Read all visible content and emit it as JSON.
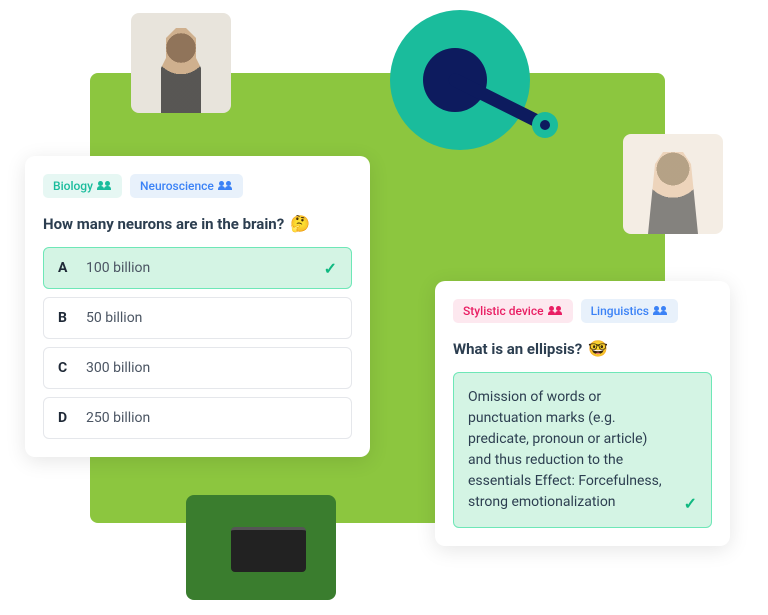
{
  "card1": {
    "tags": [
      {
        "label": "Biology",
        "style": "green"
      },
      {
        "label": "Neuroscience",
        "style": "blue"
      }
    ],
    "question": "How many neurons are in the brain?",
    "emoji": "🤔",
    "options": [
      {
        "letter": "A",
        "text": "100 billion",
        "correct": true
      },
      {
        "letter": "B",
        "text": "50 billion",
        "correct": false
      },
      {
        "letter": "C",
        "text": "300 billion",
        "correct": false
      },
      {
        "letter": "D",
        "text": "250 billion",
        "correct": false
      }
    ]
  },
  "card2": {
    "tags": [
      {
        "label": "Stylistic device",
        "style": "pink"
      },
      {
        "label": "Linguistics",
        "style": "blue"
      }
    ],
    "question": "What is an ellipsis?",
    "emoji": "🤓",
    "answer": "Omission of words or punctuation marks (e.g. predicate, pronoun or article) and thus reduction to the essentials Effect: Forcefulness, strong emotionalization"
  }
}
